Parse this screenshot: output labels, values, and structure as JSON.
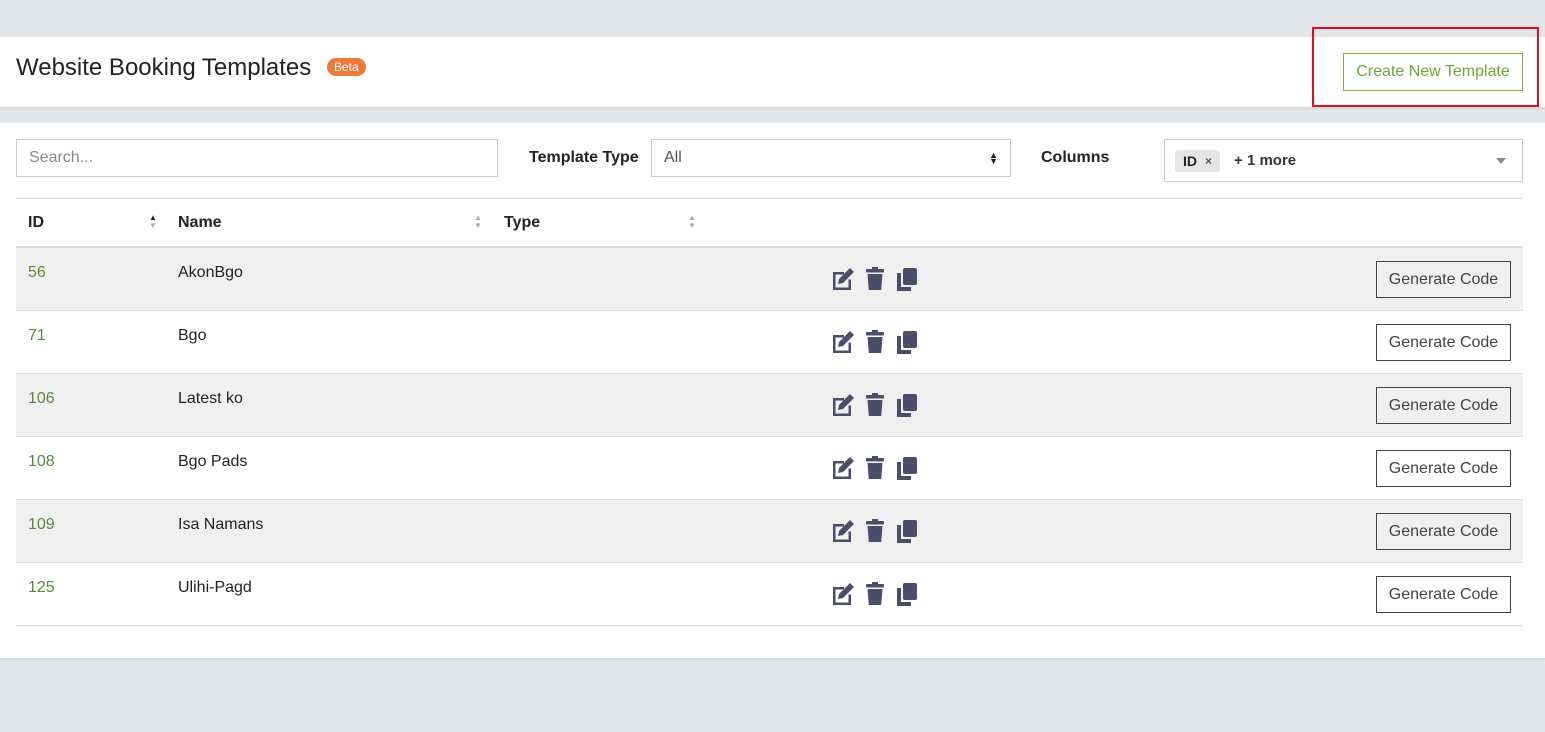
{
  "header": {
    "title": "Website Booking Templates",
    "badge": "Beta",
    "create_button": "Create New Template"
  },
  "filters": {
    "search_placeholder": "Search...",
    "template_type_label": "Template Type",
    "template_type_value": "All",
    "columns_label": "Columns",
    "columns_chip": "ID",
    "columns_chip_remove": "×",
    "columns_more": "+ 1 more"
  },
  "table": {
    "headers": [
      "ID",
      "Name",
      "Type"
    ],
    "rows": [
      {
        "id": "56",
        "name": "AkonBgo"
      },
      {
        "id": "71",
        "name": "Bgo"
      },
      {
        "id": "106",
        "name": "Latest ko"
      },
      {
        "id": "108",
        "name": "Bgo Pads"
      },
      {
        "id": "109",
        "name": "Isa Namans"
      },
      {
        "id": "125",
        "name": "Ulihi-Pagd"
      }
    ],
    "row_button": "Generate Code",
    "action_icons": [
      "edit-icon",
      "trash-icon",
      "copy-icon"
    ]
  },
  "colors": {
    "accent_green": "#6fa63a",
    "badge_orange": "#f07a3a",
    "highlight_red": "#e0101e",
    "icon_slate": "#4a4e6a"
  }
}
